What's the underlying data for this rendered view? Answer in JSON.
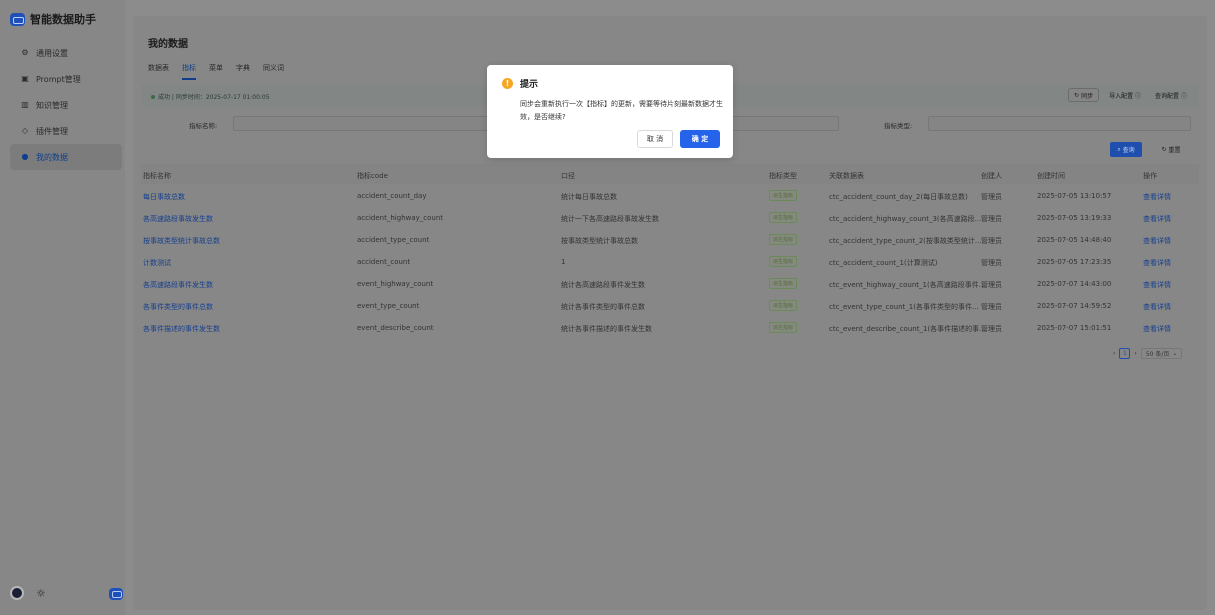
{
  "app": {
    "title": "智能数据助手"
  },
  "sidebar": {
    "items": [
      {
        "label": "通用设置",
        "icon": "settings-icon"
      },
      {
        "label": "Prompt管理",
        "icon": "prompt-icon"
      },
      {
        "label": "知识管理",
        "icon": "book-icon"
      },
      {
        "label": "插件管理",
        "icon": "plugin-icon"
      },
      {
        "label": "我的数据",
        "icon": "data-icon"
      }
    ],
    "active": "我的数据"
  },
  "page": {
    "title": "我的数据",
    "tabs": [
      "数据表",
      "指标",
      "菜单",
      "字典",
      "同义词"
    ],
    "active_tab": "指标"
  },
  "status": {
    "text": "成功 | 同步时间：2025-07-17 01:00:05",
    "sync": "同步",
    "import_config": "导入配置",
    "query_config": "查询配置"
  },
  "filters": {
    "metric_name_label": "指标名称:",
    "metric_type_label": "指标类型:",
    "query": "查询",
    "reset": "重置"
  },
  "table": {
    "headers": [
      "指标名称",
      "指标code",
      "口径",
      "指标类型",
      "关联数据表",
      "创建人",
      "创建时间",
      "操作"
    ],
    "rows": [
      {
        "name": "每日事故总数",
        "code": "accident_count_day",
        "caliber": "统计每日事故总数",
        "type": "派生指标",
        "table": "ctc_accident_count_day_2(每日事故总数)",
        "creator": "管理员",
        "time": "2025-07-05 13:10:57",
        "op": "查看详情"
      },
      {
        "name": "各高速路段事故发生数",
        "code": "accident_highway_count",
        "caliber": "统计一下各高速路段事故发生数",
        "type": "派生指标",
        "table": "ctc_accident_highway_count_3(各高速路段...",
        "creator": "管理员",
        "time": "2025-07-05 13:19:33",
        "op": "查看详情"
      },
      {
        "name": "按事故类型统计事故总数",
        "code": "accident_type_count",
        "caliber": "按事故类型统计事故总数",
        "type": "派生指标",
        "table": "ctc_accident_type_count_2(按事故类型统计...",
        "creator": "管理员",
        "time": "2025-07-05 14:48:40",
        "op": "查看详情"
      },
      {
        "name": "计数测试",
        "code": "accident_count",
        "caliber": "1",
        "type": "派生指标",
        "table": "ctc_accident_count_1(计算测试)",
        "creator": "管理员",
        "time": "2025-07-05 17:23:35",
        "op": "查看详情"
      },
      {
        "name": "各高速路段事件发生数",
        "code": "event_highway_count",
        "caliber": "统计各高速路段事件发生数",
        "type": "派生指标",
        "table": "ctc_event_highway_count_1(各高速路段事件...",
        "creator": "管理员",
        "time": "2025-07-07 14:43:00",
        "op": "查看详情"
      },
      {
        "name": "各事件类型的事件总数",
        "code": "event_type_count",
        "caliber": "统计各事件类型的事件总数",
        "type": "派生指标",
        "table": "ctc_event_type_count_1(各事件类型的事件...",
        "creator": "管理员",
        "time": "2025-07-07 14:59:52",
        "op": "查看详情"
      },
      {
        "name": "各事件描述的事件发生数",
        "code": "event_describe_count",
        "caliber": "统计各事件描述的事件发生数",
        "type": "派生指标",
        "table": "ctc_event_describe_count_1(各事件描述的事...",
        "creator": "管理员",
        "time": "2025-07-07 15:01:51",
        "op": "查看详情"
      }
    ]
  },
  "pager": {
    "current": "1",
    "page_size": "50 条/页"
  },
  "modal": {
    "title": "提示",
    "body": "同步会重新执行一次【指标】的更新，需要等待片刻最新数据才生效，是否继续?",
    "cancel": "取 消",
    "ok": "确 定"
  },
  "colors": {
    "primary": "#2563eb",
    "warning": "#f5a623"
  }
}
